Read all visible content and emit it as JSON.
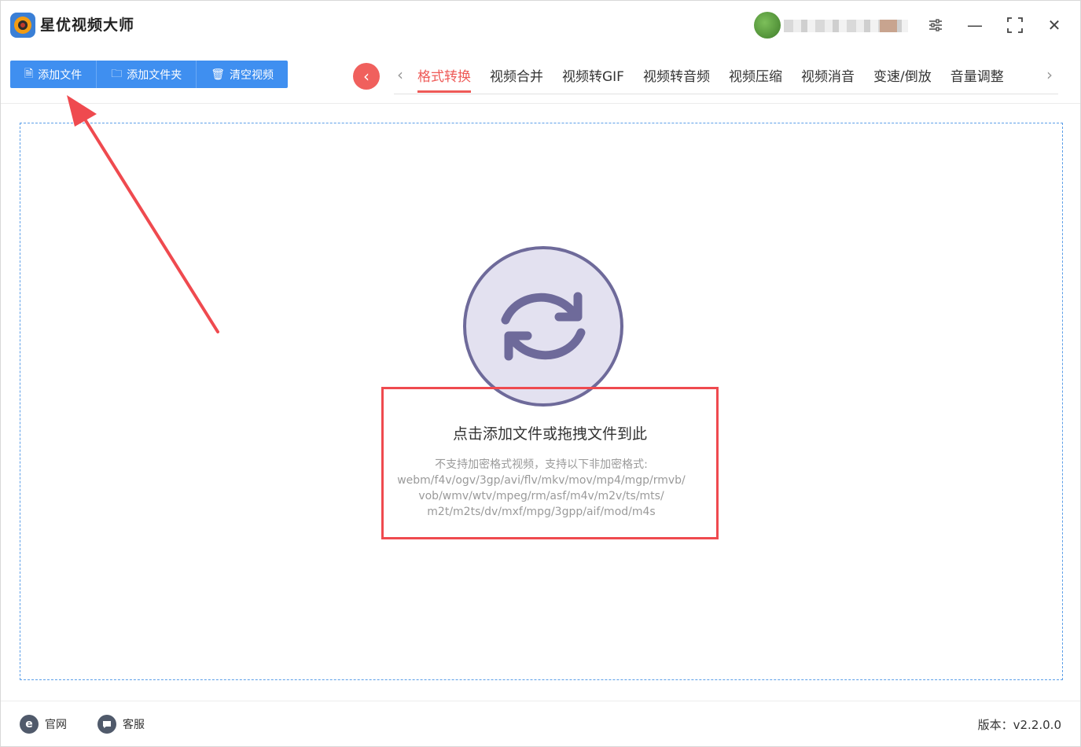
{
  "app": {
    "title": "星优视频大师"
  },
  "window_controls": {
    "settings_icon": "sliders-icon",
    "minimize_glyph": "—",
    "maximize_glyph": "⛶",
    "close_glyph": "✕"
  },
  "toolbar": {
    "buttons": [
      {
        "label": "添加文件",
        "icon": "file-icon",
        "glyph": "🗎"
      },
      {
        "label": "添加文件夹",
        "icon": "folder-icon",
        "glyph": "🗀"
      },
      {
        "label": "清空视频",
        "icon": "trash-icon",
        "glyph": "🗑"
      }
    ]
  },
  "nav": {
    "back_glyph": "‹",
    "prev_glyph": "‹",
    "next_glyph": "›",
    "tabs": [
      "格式转换",
      "视频合并",
      "视频转GIF",
      "视频转音频",
      "视频压缩",
      "视频消音",
      "变速/倒放",
      "音量调整"
    ],
    "active_tab": "格式转换"
  },
  "dropzone": {
    "icon": "convert-refresh-icon",
    "title": "点击添加文件或拖拽文件到此",
    "subtitle_lines": [
      "不支持加密格式视频，支持以下非加密格式:",
      "webm/f4v/ogv/3gp/avi/flv/mkv/mov/mp4/mgp/rmvb/",
      "vob/wmv/wtv/mpeg/rm/asf/m4v/m2v/ts/mts/",
      "m2t/m2ts/dv/mxf/mpg/3gpp/aif/mod/m4s"
    ]
  },
  "footer": {
    "website_label": "官网",
    "website_icon": "e",
    "support_label": "客服",
    "support_icon": "chat-bubble-icon",
    "version": "版本：v2.2.0.0"
  },
  "colors": {
    "accent_blue": "#3f8ff0",
    "accent_red": "#ee5a57",
    "annotation_red": "#ef4a4f",
    "icon_purple": "#6e6a9a",
    "icon_fill": "#e3e1f0"
  }
}
